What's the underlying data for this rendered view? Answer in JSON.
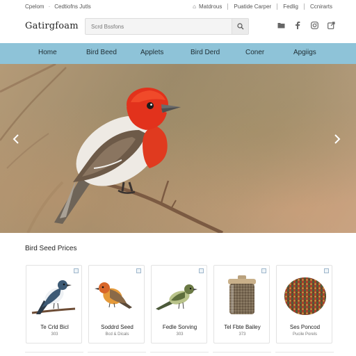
{
  "util_bar": {
    "left": [
      "Cpelom",
      "Cedtiofns Jutls"
    ],
    "right": [
      "Matdrous",
      "Puatide Carper",
      "Fedlig",
      "Ccnirarts"
    ]
  },
  "header": {
    "logo": "Gatirgfoam",
    "search_placeholder": "Scrd Bssfons",
    "icons": [
      "folder-icon",
      "facebook-icon",
      "instagram-icon",
      "share-icon"
    ]
  },
  "nav": {
    "items": [
      "Home",
      "Bird Beed",
      "Applets",
      "Bird Derd",
      "Coner",
      "Apgiigs"
    ]
  },
  "hero": {
    "prev_label": "‹",
    "next_label": "›"
  },
  "section": {
    "title": "Bird Seed Prices"
  },
  "products": [
    {
      "name": "Te Crld Bicl",
      "sub": "303"
    },
    {
      "name": "Soddrd Seed",
      "sub": "Bcd & Dicals"
    },
    {
      "name": "Fedle Sorving",
      "sub": "303"
    },
    {
      "name": "Tel Fbte Bailey",
      "sub": "373"
    },
    {
      "name": "Ses Poncod",
      "sub": "Pucile Porels"
    }
  ],
  "colors": {
    "nav_bg": "#8ec3d8",
    "bird_red": "#e2321c"
  }
}
